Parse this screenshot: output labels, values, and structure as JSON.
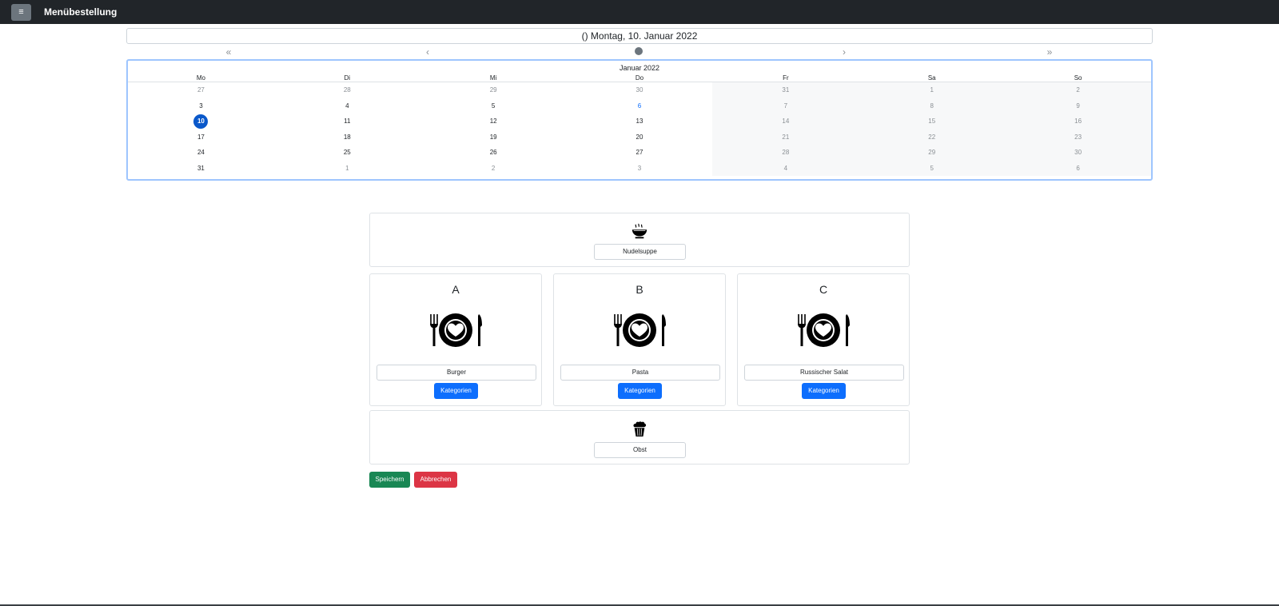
{
  "navbar": {
    "menu_icon": "hamburger-icon",
    "menu_glyph": "≡",
    "title": "Menübestellung"
  },
  "date_header": {
    "text": "() Montag, 10. Januar 2022"
  },
  "calendar_nav": {
    "prev_year": "«",
    "prev_month": "‹",
    "next_month": "›",
    "next_year": "»"
  },
  "calendar": {
    "month_label": "Januar 2022",
    "weekdays": [
      "Mo",
      "Di",
      "Mi",
      "Do",
      "Fr",
      "Sa",
      "So"
    ],
    "weeks": [
      [
        "27",
        "28",
        "29",
        "30",
        "31",
        "1",
        "2"
      ],
      [
        "3",
        "4",
        "5",
        "6",
        "7",
        "8",
        "9"
      ],
      [
        "10",
        "11",
        "12",
        "13",
        "14",
        "15",
        "16"
      ],
      [
        "17",
        "18",
        "19",
        "20",
        "21",
        "22",
        "23"
      ],
      [
        "24",
        "25",
        "26",
        "27",
        "28",
        "29",
        "30"
      ],
      [
        "31",
        "1",
        "2",
        "3",
        "4",
        "5",
        "6"
      ]
    ],
    "selected_day": "10",
    "highlighted_day": "6"
  },
  "soup": {
    "icon": "soup-bowl-icon",
    "value": "Nudelsuppe"
  },
  "main_courses": [
    {
      "letter": "A",
      "icon": "plate-cutlery-heart-icon",
      "value": "Burger",
      "button": "Kategorien"
    },
    {
      "letter": "B",
      "icon": "plate-cutlery-heart-icon",
      "value": "Pasta",
      "button": "Kategorien"
    },
    {
      "letter": "C",
      "icon": "plate-cutlery-heart-icon",
      "value": "Russischer Salat",
      "button": "Kategorien"
    }
  ],
  "dessert": {
    "icon": "muffin-icon",
    "value": "Obst"
  },
  "actions": {
    "save_label": "Speichern",
    "cancel_label": "Abbrechen"
  },
  "colors": {
    "navbar": "#212529",
    "primary": "#0d6efd",
    "success": "#198754",
    "danger": "#dc3545",
    "calendar_border": "#9ec5fe"
  }
}
